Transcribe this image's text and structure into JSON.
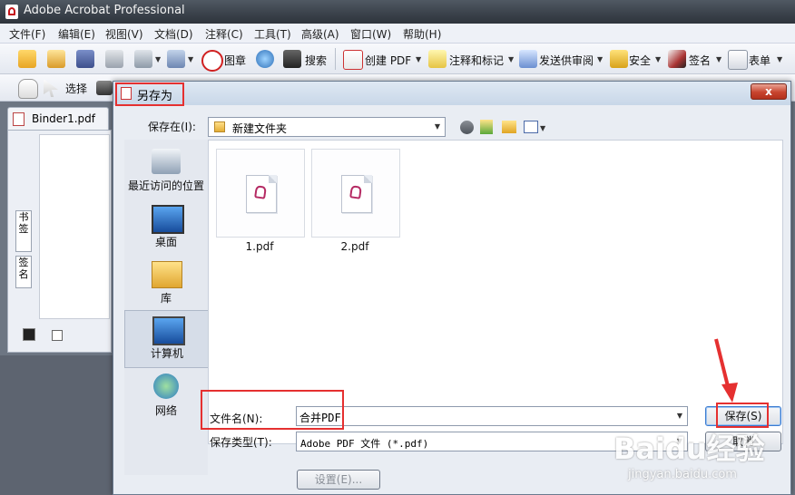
{
  "app": {
    "title": "Adobe Acrobat Professional",
    "menu": [
      "文件(F)",
      "编辑(E)",
      "视图(V)",
      "文档(D)",
      "注释(C)",
      "工具(T)",
      "高级(A)",
      "窗口(W)",
      "帮助(H)"
    ],
    "toolbar": {
      "seal": "图章",
      "search": "搜索",
      "create_pdf": "创建 PDF",
      "comment_markup": "注释和标记",
      "send_review": "发送供审阅",
      "security": "安全",
      "sign": "签名",
      "forms": "表单",
      "select": "选择"
    },
    "document_tab": "Binder1.pdf",
    "side_tabs": [
      "书签",
      "签名"
    ]
  },
  "dialog": {
    "title": "另存为",
    "close_label": "x",
    "save_in_label": "保存在(I):",
    "save_in_value": "新建文件夹",
    "places": [
      {
        "label": "最近访问的位置",
        "icon": "recent-places-icon"
      },
      {
        "label": "桌面",
        "icon": "desktop-icon"
      },
      {
        "label": "库",
        "icon": "libraries-icon"
      },
      {
        "label": "计算机",
        "icon": "computer-icon"
      },
      {
        "label": "网络",
        "icon": "network-icon"
      }
    ],
    "files": [
      {
        "name": "1.pdf",
        "icon": "pdf-file-icon"
      },
      {
        "name": "2.pdf",
        "icon": "pdf-file-icon"
      }
    ],
    "filename_label": "文件名(N):",
    "filename_value": "合并PDF",
    "filetype_label": "保存类型(T):",
    "filetype_value": "Adobe PDF 文件 (*.pdf)",
    "save_button": "保存(S)",
    "cancel_button": "取消",
    "settings_button": "设置(E)..."
  },
  "watermark": {
    "brand": "Baidu经验",
    "url": "jingyan.baidu.com"
  },
  "colors": {
    "highlight": "#e53030",
    "arrow": "#e53030"
  }
}
